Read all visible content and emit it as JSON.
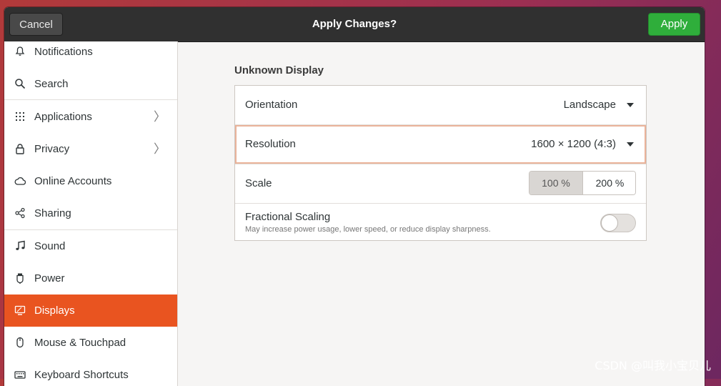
{
  "headerbar": {
    "title": "Apply Changes?",
    "cancel_label": "Cancel",
    "apply_label": "Apply",
    "apply_color": "#2fae3b"
  },
  "sidebar": {
    "items": [
      {
        "label": "Notifications",
        "icon": "bell-icon"
      },
      {
        "label": "Search",
        "icon": "search-icon"
      },
      {
        "label": "Applications",
        "icon": "app-grid-icon",
        "has_arrow": true
      },
      {
        "label": "Privacy",
        "icon": "lock-icon",
        "has_arrow": true
      },
      {
        "label": "Online Accounts",
        "icon": "cloud-icon"
      },
      {
        "label": "Sharing",
        "icon": "share-icon"
      },
      {
        "label": "Sound",
        "icon": "music-note-icon"
      },
      {
        "label": "Power",
        "icon": "power-icon"
      },
      {
        "label": "Displays",
        "icon": "display-icon",
        "active": true
      },
      {
        "label": "Mouse & Touchpad",
        "icon": "mouse-icon"
      },
      {
        "label": "Keyboard Shortcuts",
        "icon": "keyboard-icon"
      }
    ],
    "arrow_glyph": "〉",
    "active_color": "#e95420"
  },
  "display": {
    "section_title": "Unknown Display",
    "orientation": {
      "label": "Orientation",
      "value": "Landscape"
    },
    "resolution": {
      "label": "Resolution",
      "value": "1600 × 1200 (4:3)"
    },
    "scale": {
      "label": "Scale",
      "options": [
        "100 %",
        "200 %"
      ],
      "selected": "100 %"
    },
    "fractional_scaling": {
      "label": "Fractional Scaling",
      "description": "May increase power usage, lower speed, or reduce display sharpness.",
      "enabled": false
    }
  },
  "watermark": "CSDN @叫我小宝贝儿"
}
